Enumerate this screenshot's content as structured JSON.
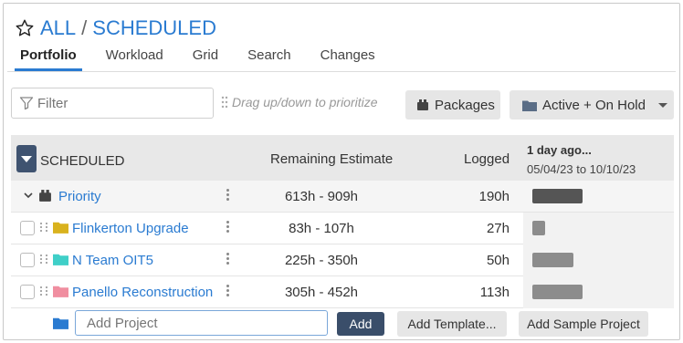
{
  "header": {
    "crumb_all": "ALL",
    "separator": "/",
    "crumb_current": "SCHEDULED"
  },
  "tabs": [
    {
      "label": "Portfolio",
      "active": true
    },
    {
      "label": "Workload",
      "active": false
    },
    {
      "label": "Grid",
      "active": false
    },
    {
      "label": "Search",
      "active": false
    },
    {
      "label": "Changes",
      "active": false
    }
  ],
  "toolbar": {
    "filter_placeholder": "Filter",
    "drag_hint": "Drag up/down to prioritize",
    "packages_label": "Packages",
    "status_label": "Active + On Hold"
  },
  "table": {
    "section_title": "SCHEDULED",
    "col_remaining": "Remaining Estimate",
    "col_logged": "Logged",
    "timeline_updated": "1 day ago...",
    "timeline_range": "05/04/23 to 10/10/23",
    "priority_row": {
      "name": "Priority",
      "remaining": "613h - 909h",
      "logged": "190h"
    },
    "rows": [
      {
        "name": "Flinkerton Upgrade",
        "remaining": "83h - 107h",
        "logged": "27h",
        "folder_color": "#d9b21e"
      },
      {
        "name": "N Team OIT5",
        "remaining": "225h - 350h",
        "logged": "50h",
        "folder_color": "#3fcfc8"
      },
      {
        "name": "Panello Reconstruction",
        "remaining": "305h - 452h",
        "logged": "113h",
        "folder_color": "#f08ea0"
      }
    ]
  },
  "add_row": {
    "placeholder": "Add Project",
    "add_label": "Add",
    "template_label": "Add Template...",
    "sample_label": "Add Sample Project"
  },
  "colors": {
    "accent": "#2a7bd1",
    "dark_button": "#3a4e6a",
    "bar_dark": "#555555",
    "bar_light": "#8c8c8c"
  }
}
